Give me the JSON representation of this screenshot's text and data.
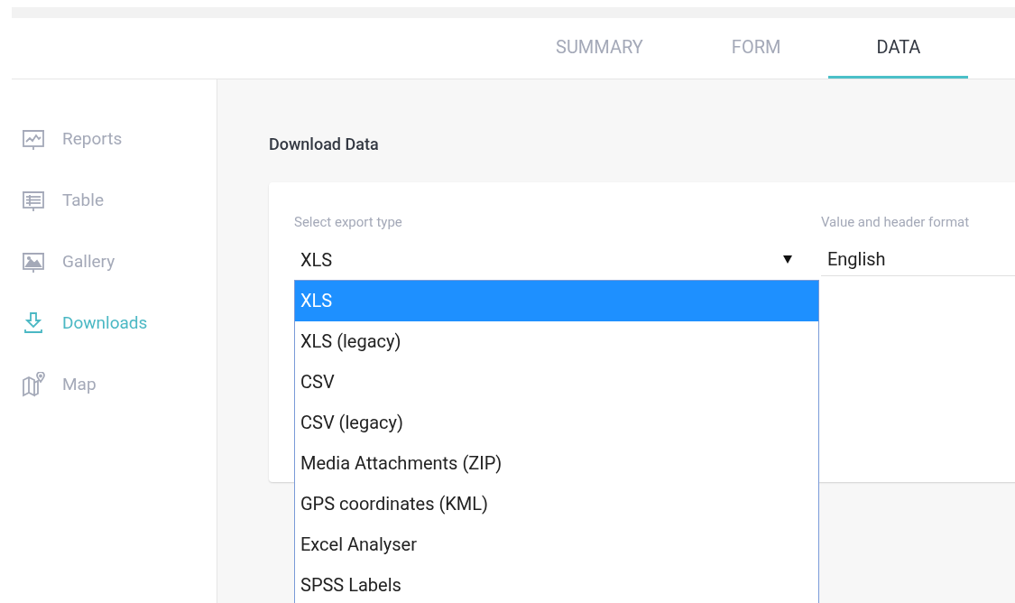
{
  "tabs": [
    {
      "label": "SUMMARY",
      "selected": false
    },
    {
      "label": "FORM",
      "selected": false
    },
    {
      "label": "DATA",
      "selected": true
    }
  ],
  "sidebar": {
    "items": [
      {
        "label": "Reports",
        "kind": "reports",
        "selected": false
      },
      {
        "label": "Table",
        "kind": "table",
        "selected": false
      },
      {
        "label": "Gallery",
        "kind": "gallery",
        "selected": false
      },
      {
        "label": "Downloads",
        "kind": "downloads",
        "selected": true
      },
      {
        "label": "Map",
        "kind": "map",
        "selected": false
      }
    ]
  },
  "section_title": "Download Data",
  "export_type": {
    "label": "Select export type",
    "value": "XLS",
    "expanded": true,
    "options": [
      {
        "label": "XLS",
        "selected": true
      },
      {
        "label": "XLS (legacy)",
        "selected": false
      },
      {
        "label": "CSV",
        "selected": false
      },
      {
        "label": "CSV (legacy)",
        "selected": false
      },
      {
        "label": "Media Attachments (ZIP)",
        "selected": false
      },
      {
        "label": "GPS coordinates (KML)",
        "selected": false
      },
      {
        "label": "Excel Analyser",
        "selected": false
      },
      {
        "label": "SPSS Labels",
        "selected": false
      }
    ]
  },
  "format": {
    "label": "Value and header format",
    "value": "English"
  }
}
